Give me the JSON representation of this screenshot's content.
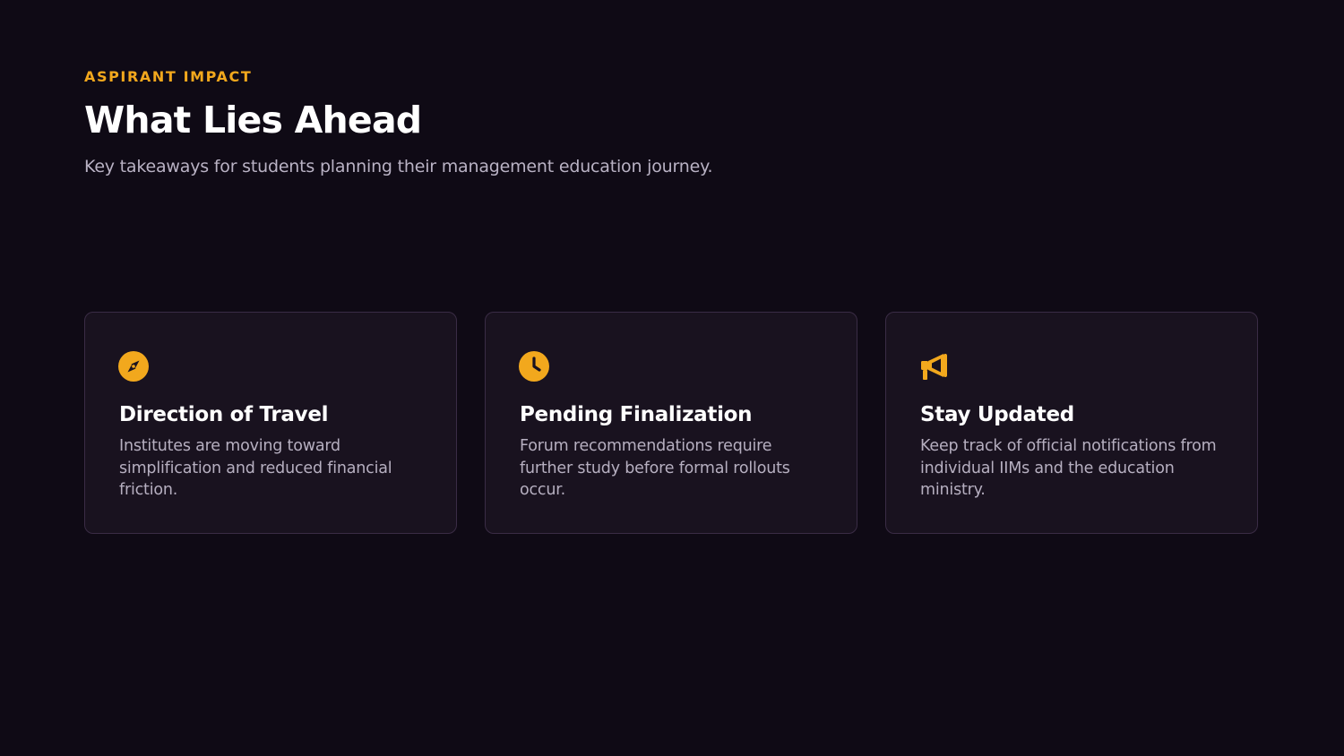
{
  "header": {
    "eyebrow": "ASPIRANT IMPACT",
    "title": "What Lies Ahead",
    "subtitle": "Key takeaways for students planning their management education journey."
  },
  "cards": [
    {
      "icon": "compass-icon",
      "title": "Direction of Travel",
      "description": "Institutes are moving toward simplification and reduced financial friction."
    },
    {
      "icon": "clock-icon",
      "title": "Pending Finalization",
      "description": "Forum recommendations require further study before formal rollouts occur."
    },
    {
      "icon": "megaphone-icon",
      "title": "Stay Updated",
      "description": "Keep track of official notifications from individual IIMs and the education ministry."
    }
  ],
  "colors": {
    "background": "#0f0a15",
    "accent": "#f2a81d",
    "card_background": "#19121f",
    "card_border": "#3a2c45",
    "muted_text": "#b6afc0"
  }
}
